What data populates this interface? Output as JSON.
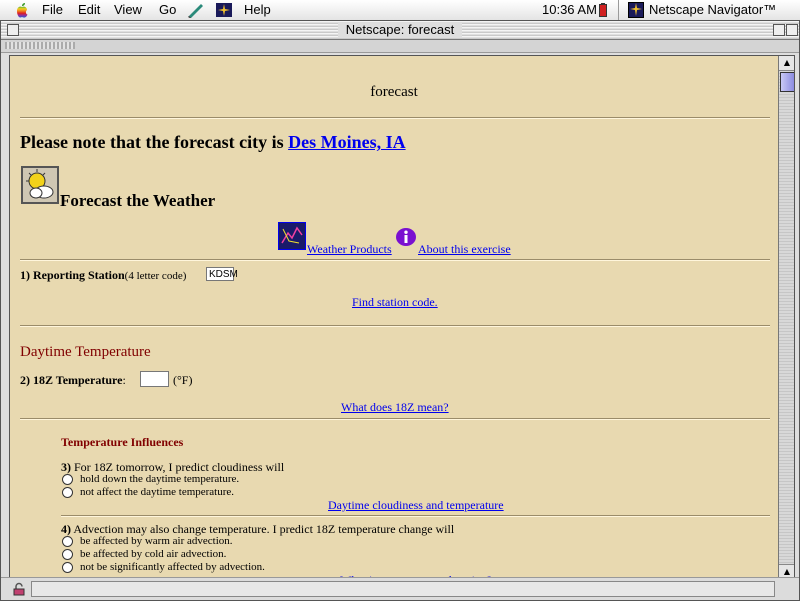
{
  "menubar": {
    "menus": [
      "File",
      "Edit",
      "View",
      "Go",
      "Help"
    ],
    "clock": "10:36 AM",
    "app_name": "Netscape Navigator™"
  },
  "window": {
    "title": "Netscape: forecast"
  },
  "page": {
    "heading": "forecast",
    "note_prefix": "Please note that the forecast city is",
    "city_link": "Des Moines, IA",
    "forecast_title": "Forecast the Weather",
    "weather_products_link": "Weather Products",
    "about_link": "About this exercise",
    "q1": {
      "number": "1)",
      "label": "Reporting Station",
      "hint": "(4 letter code)",
      "value": "KDSM",
      "find_link": "Find station code."
    },
    "daytime_section": "Daytime Temperature",
    "q2": {
      "number": "2)",
      "label": "18Z Temperature",
      "colon": ":",
      "unit": "(°F)",
      "value": "",
      "help_link": "What does 18Z mean?"
    },
    "influences_title": "Temperature Influences",
    "q3": {
      "number": "3)",
      "text": "For 18Z tomorrow, I predict cloudiness will",
      "options": [
        "hold down the daytime temperature.",
        "not affect the daytime temperature."
      ],
      "help_link": "Daytime cloudiness and temperature"
    },
    "q4": {
      "number": "4)",
      "text": "Advection may also change temperature. I predict 18Z temperature change will",
      "options": [
        "be affected by warm air advection.",
        "be affected by cold air advection.",
        "not be significantly affected by advection."
      ],
      "help_link": "What is temperature advection?"
    }
  },
  "colors": {
    "page_background": "#e8d9b0",
    "link": "#0000ee",
    "section_heading": "#800000"
  }
}
